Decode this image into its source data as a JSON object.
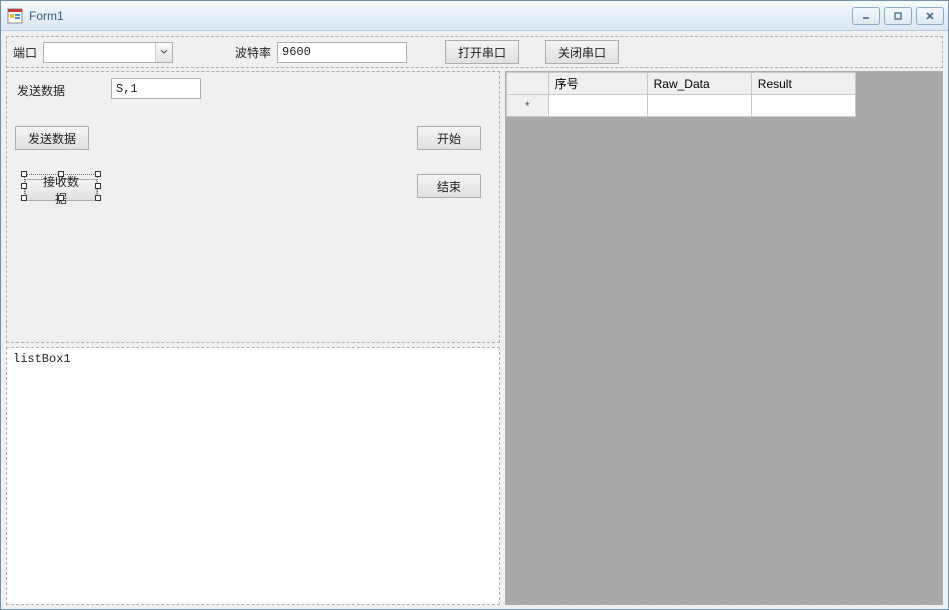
{
  "window": {
    "title": "Form1"
  },
  "toolbar": {
    "port_label": "端口",
    "port_value": "",
    "baud_label": "波特率",
    "baud_value": "9600",
    "open_port_label": "打开串口",
    "close_port_label": "关闭串口"
  },
  "send_panel": {
    "send_data_label": "发送数据",
    "send_data_value": "S,1",
    "send_button_label": "发送数据",
    "start_button_label": "开始",
    "receive_button_label": "接收数据",
    "end_button_label": "结束"
  },
  "listbox": {
    "item0": "listBox1"
  },
  "grid": {
    "columns": {
      "col1": "序号",
      "col2": "Raw_Data",
      "col3": "Result"
    },
    "new_row_marker": "*"
  }
}
